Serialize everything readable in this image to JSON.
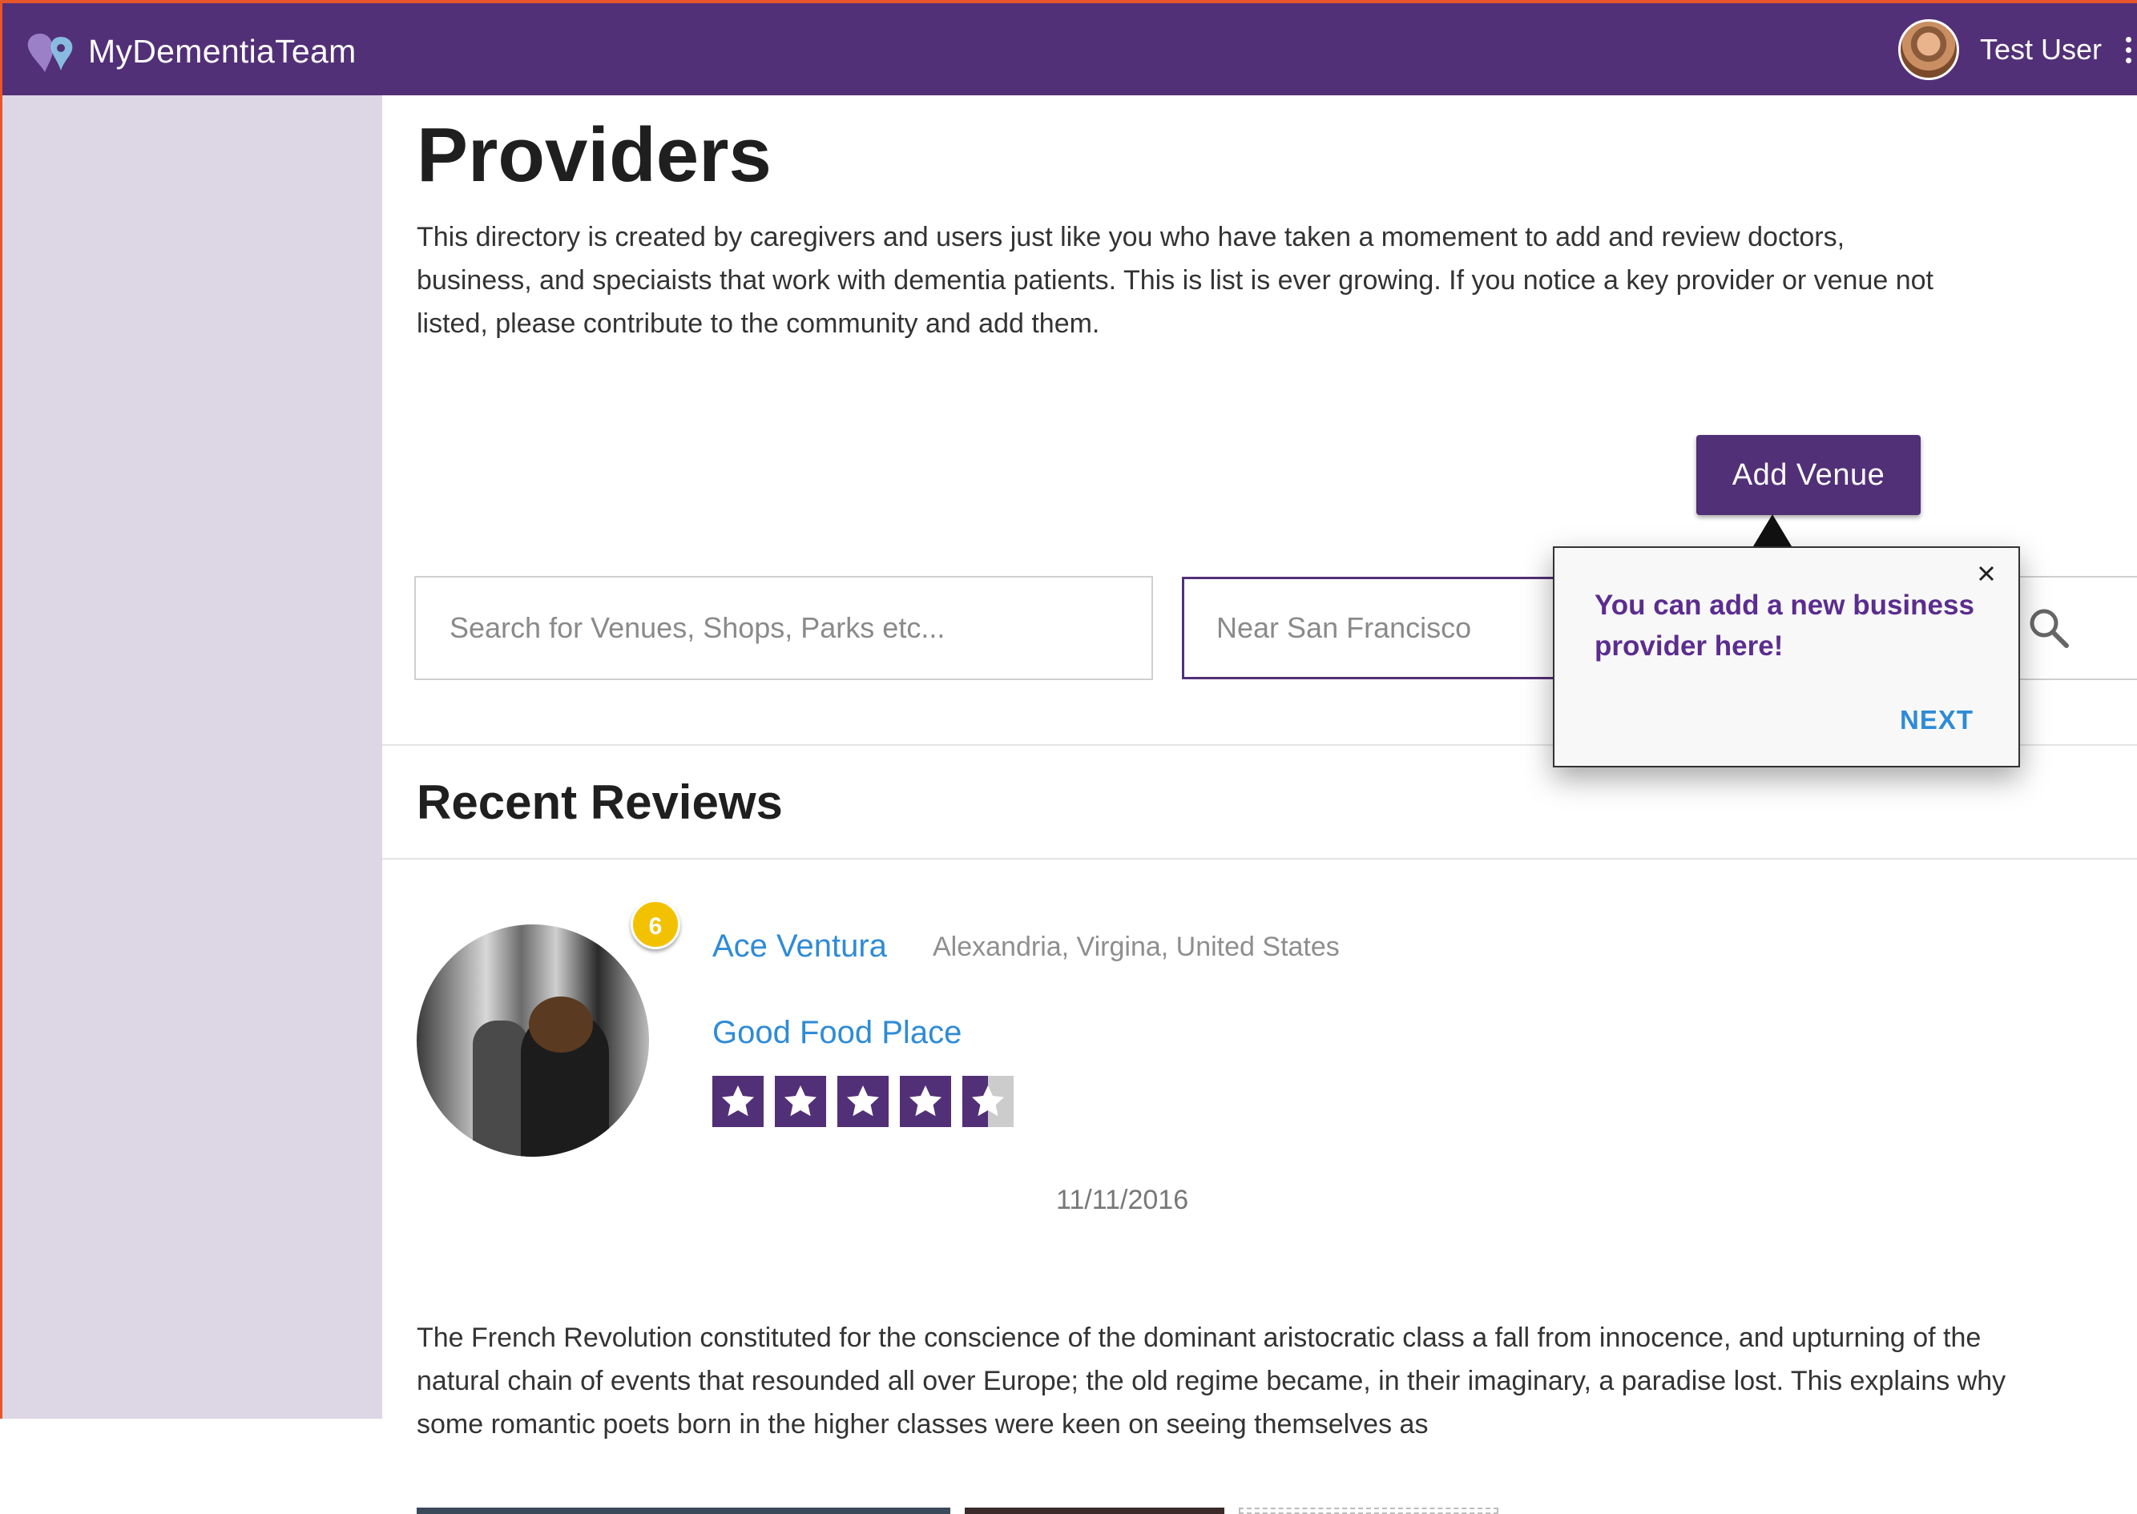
{
  "app": {
    "name": "MyDementiaTeam",
    "logo_icon": "heart-pin-logo-icon"
  },
  "user": {
    "name": "Test User",
    "menu_icon": "kebab-menu-icon"
  },
  "page": {
    "title": "Providers",
    "intro": "This directory is created by caregivers and users just like you who have taken a momement to add and review doctors, business, and speciaists that work with dementia patients. This is list is ever growing. If you notice a key provider or venue not listed, please contribute to the community and add them."
  },
  "actions": {
    "add_venue": "Add Venue"
  },
  "search": {
    "query_placeholder": "Search for Venues, Shops, Parks etc...",
    "near_placeholder": "Near San Francisco",
    "icon": "search-icon"
  },
  "tooltip": {
    "message": "You can add a new business provider here!",
    "next": "NEXT",
    "close_icon": "close-icon"
  },
  "reviews": {
    "title": "Recent Reviews",
    "items": [
      {
        "badge": "6",
        "reviewer": "Ace Ventura",
        "location": "Alexandria, Virgina, United States",
        "venue": "Good Food Place",
        "rating": 4.5,
        "rating_max": 5,
        "date": "11/11/2016",
        "text": "The French Revolution constituted for the conscience of the dominant aristocratic class a fall from innocence, and upturning of the natural chain of events that resounded all over Europe; the old regime became, in their imaginary, a paradise lost. This explains why some romantic poets born in the higher classes were keen on seeing themselves as"
      }
    ]
  },
  "colors": {
    "brand_purple": "#523077",
    "sidebar": "#dcd6e5",
    "link_blue": "#2f8bd6",
    "badge_yellow": "#f2c200",
    "tooltip_text": "#5b2d8e"
  }
}
